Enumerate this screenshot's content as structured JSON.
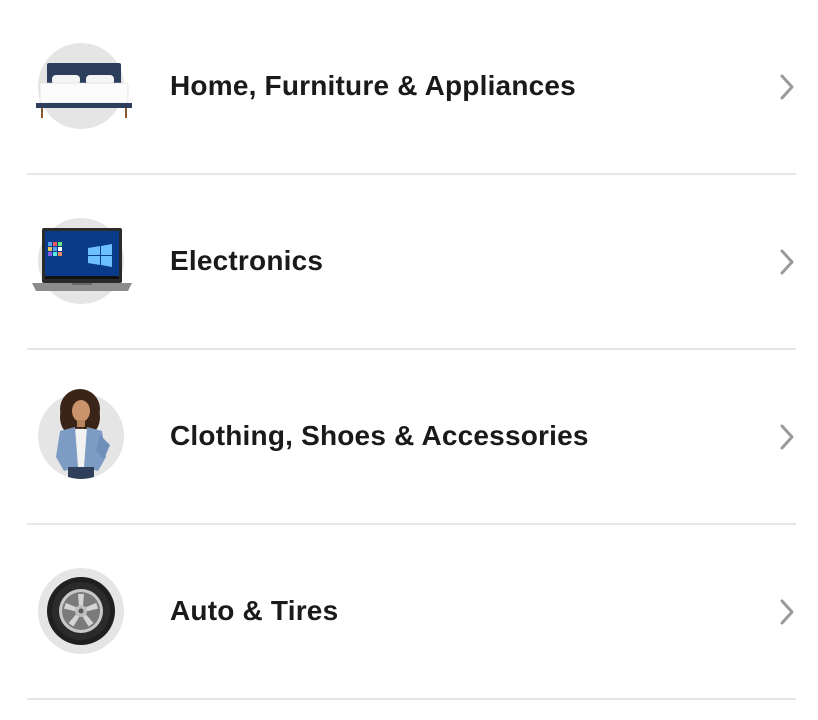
{
  "categories": [
    {
      "label": "Home, Furniture & Appliances",
      "thumbnail": "bed-image"
    },
    {
      "label": "Electronics",
      "thumbnail": "laptop-image"
    },
    {
      "label": "Clothing, Shoes & Accessories",
      "thumbnail": "woman-in-denim-jacket-image"
    },
    {
      "label": "Auto & Tires",
      "thumbnail": "tire-image"
    }
  ],
  "icons": {
    "chevron": "chevron-right-icon"
  },
  "colors": {
    "text": "#1a1a1a",
    "divider": "#e6e6e6",
    "thumb_bg": "#e5e5e5",
    "chevron": "#9a9a9a"
  }
}
